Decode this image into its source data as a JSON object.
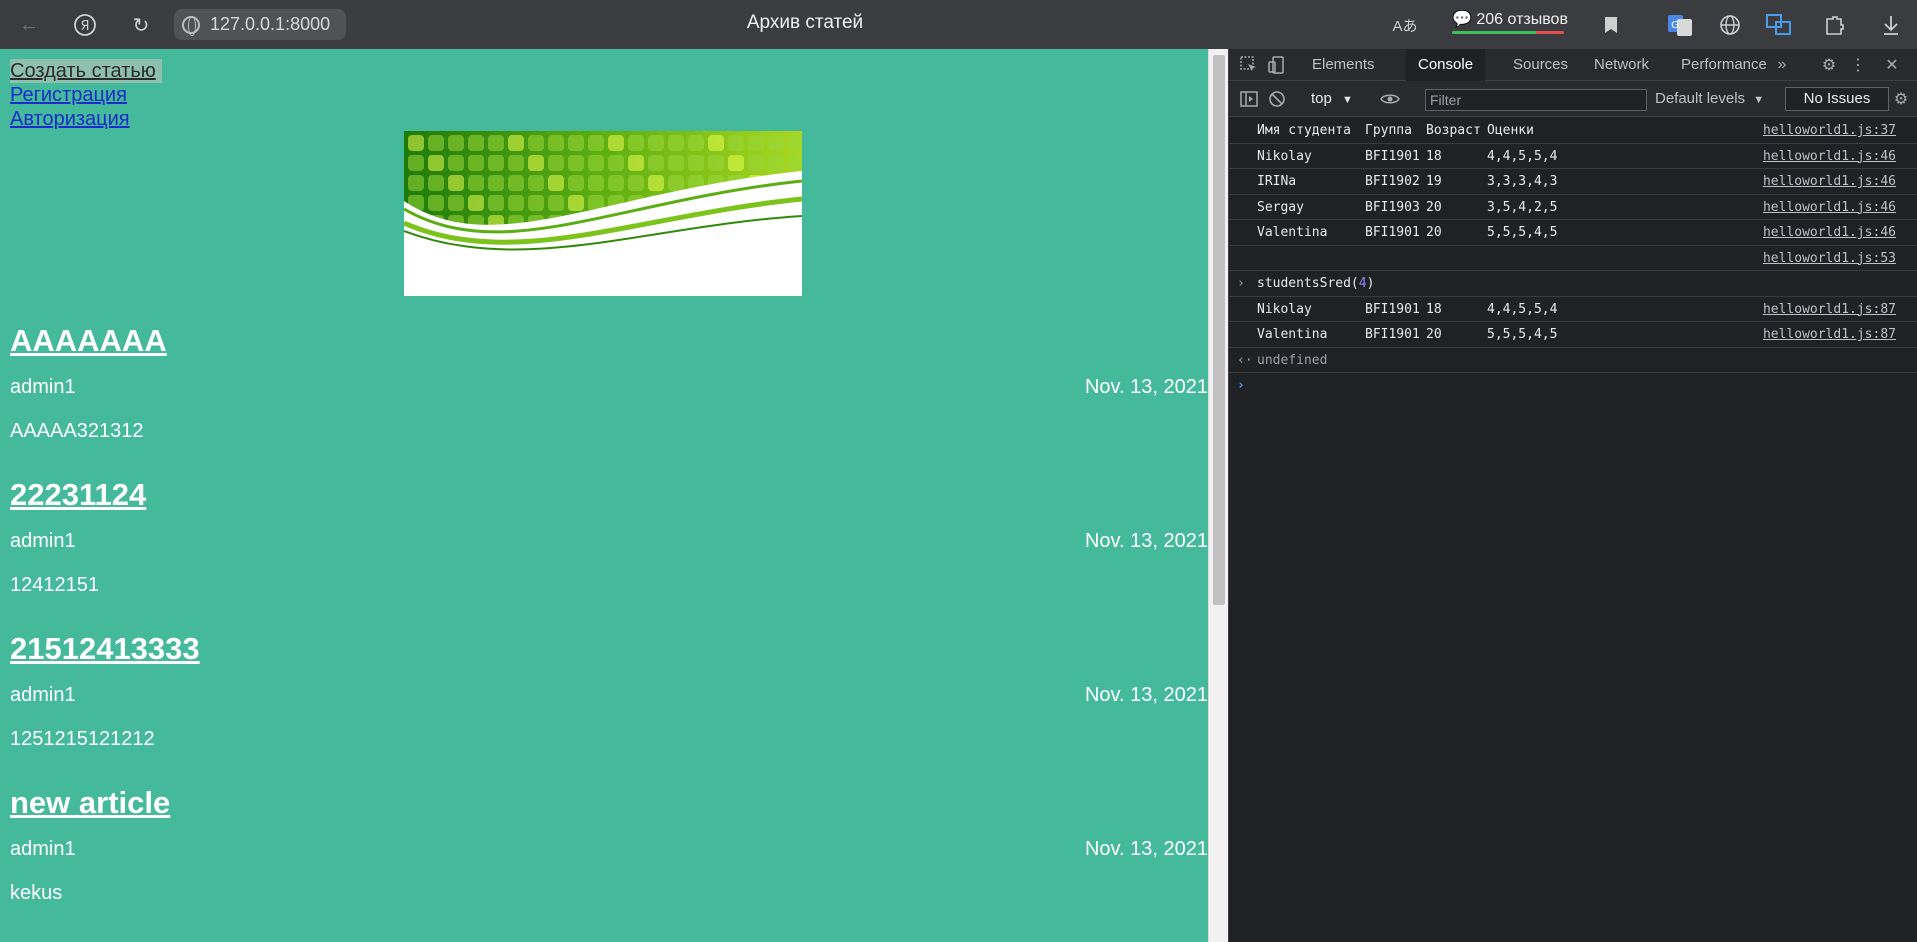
{
  "browser": {
    "title": "Архив статей",
    "url": "127.0.0.1:8000",
    "reviews": "206 отзывов"
  },
  "page": {
    "nav": [
      {
        "label": "Создать статью"
      },
      {
        "label": "Регистрация"
      },
      {
        "label": "Авторизация"
      }
    ],
    "articles": [
      {
        "title": "AAAAAAA",
        "author": "admin1",
        "date": "Nov. 13, 2021",
        "body": "AAAAA321312"
      },
      {
        "title": "22231124",
        "author": "admin1",
        "date": "Nov. 13, 2021",
        "body": "12412151"
      },
      {
        "title": "21512413333",
        "author": "admin1",
        "date": "Nov. 13, 2021",
        "body": "1251215121212"
      },
      {
        "title": "new article",
        "author": "admin1",
        "date": "Nov. 13, 2021",
        "body": "kekus"
      }
    ]
  },
  "devtools": {
    "tabs": [
      "Elements",
      "Console",
      "Sources",
      "Network",
      "Performance"
    ],
    "active_tab": "Console",
    "context": "top",
    "filter_placeholder": "Filter",
    "levels": "Default levels",
    "issues": "No Issues",
    "table_header": {
      "name": "Имя студента",
      "group": "Группа",
      "age": "Возраст",
      "grades": "Оценки",
      "src": "helloworld1.js:37"
    },
    "students": [
      {
        "name": "Nikolay",
        "group": "BFI1901",
        "age": "18",
        "grades": "4,4,5,5,4",
        "src": "helloworld1.js:46"
      },
      {
        "name": "IRINa",
        "group": "BFI1902",
        "age": "19",
        "grades": "3,3,3,4,3",
        "src": "helloworld1.js:46"
      },
      {
        "name": "Sergay",
        "group": "BFI1903",
        "age": "20",
        "grades": "3,5,4,2,5",
        "src": "helloworld1.js:46"
      },
      {
        "name": "Valentina",
        "group": "BFI1901",
        "age": "20",
        "grades": "5,5,5,4,5",
        "src": "helloworld1.js:46"
      }
    ],
    "empty_src": "helloworld1.js:53",
    "command": {
      "fn": "studentsSred(",
      "arg": "4",
      "close": ")"
    },
    "results": [
      {
        "name": "Nikolay",
        "group": "BFI1901",
        "age": "18",
        "grades": "4,4,5,5,4",
        "src": "helloworld1.js:87"
      },
      {
        "name": "Valentina",
        "group": "BFI1901",
        "age": "20",
        "grades": "5,5,5,4,5",
        "src": "helloworld1.js:87"
      }
    ],
    "return_value": "undefined"
  }
}
